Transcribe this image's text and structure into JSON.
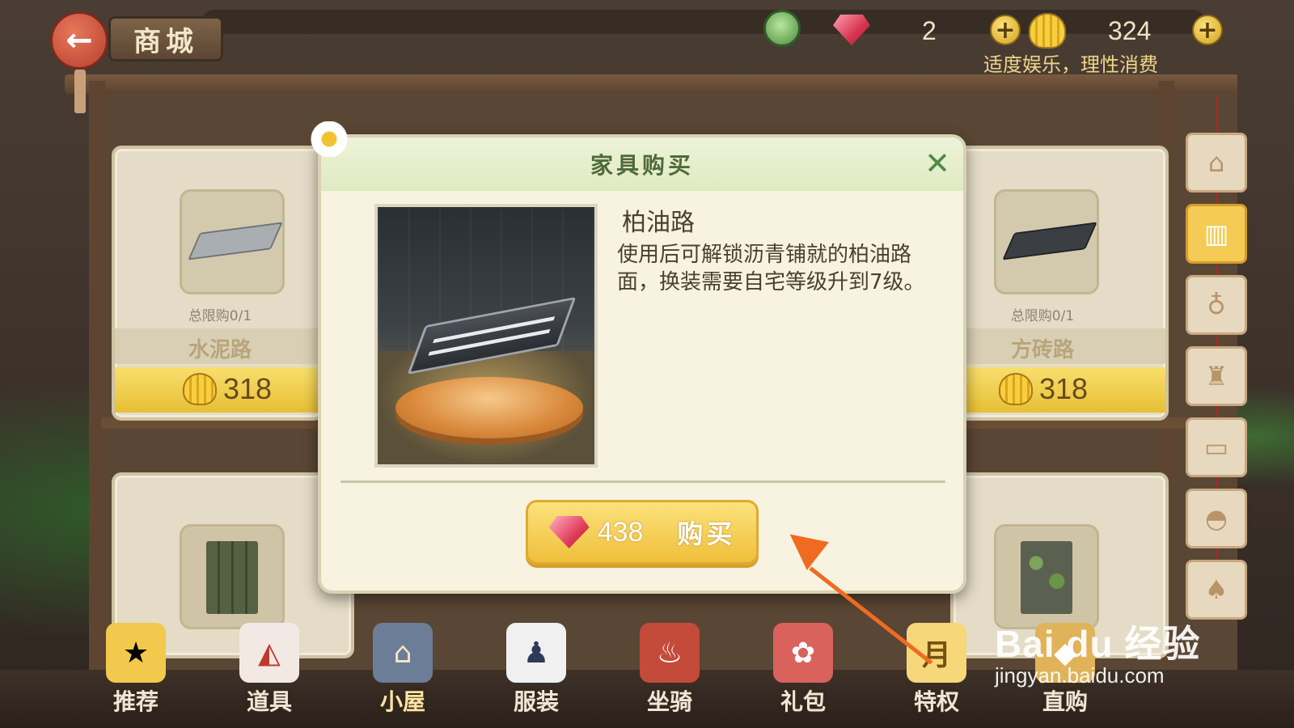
{
  "top_bar": {
    "back_icon": "arrow-left-icon",
    "title": "商城",
    "gem_count": "2",
    "shell_count": "324",
    "notice": "适度娱乐，理性消费"
  },
  "shelf": {
    "cards": [
      {
        "limit": "总限购0/1",
        "name": "水泥路",
        "price": "318",
        "tile_color": "#a8aeb2"
      },
      {
        "limit": "总限购0/1",
        "name": "方砖路",
        "price": "318",
        "tile_color": "#3b3f44"
      }
    ]
  },
  "side_tabs": [
    {
      "icon": "house-icon",
      "glyph": "⌂"
    },
    {
      "icon": "fence-icon",
      "glyph": "▥"
    },
    {
      "icon": "table-icon",
      "glyph": "♁"
    },
    {
      "icon": "chair-icon",
      "glyph": "♜"
    },
    {
      "icon": "bed-icon",
      "glyph": "▭"
    },
    {
      "icon": "fan-icon",
      "glyph": "◓"
    },
    {
      "icon": "lamp-icon",
      "glyph": "♠"
    }
  ],
  "bottom_nav": [
    {
      "label": "推荐",
      "icon": "star-icon",
      "glyph": "★",
      "bg": "#f2c94c"
    },
    {
      "label": "道具",
      "icon": "fox-mask-icon",
      "glyph": "◭",
      "bg": "#f3e9e4"
    },
    {
      "label": "小屋",
      "icon": "house-icon",
      "glyph": "⌂",
      "bg": "#6c7d97"
    },
    {
      "label": "服装",
      "icon": "uniform-icon",
      "glyph": "♟",
      "bg": "#f0f0f0"
    },
    {
      "label": "坐骑",
      "icon": "bicycle-icon",
      "glyph": "♨",
      "bg": "#c44b3a"
    },
    {
      "label": "礼包",
      "icon": "gift-icon",
      "glyph": "✿",
      "bg": "#d9625c"
    },
    {
      "label": "特权",
      "icon": "monthly-card-icon",
      "glyph": "月",
      "bg": "#f6d77a"
    },
    {
      "label": "直购",
      "icon": "direct-buy-icon",
      "glyph": "◆",
      "bg": "#e0b35a"
    }
  ],
  "dialog": {
    "title": "家具购买",
    "close_icon": "close-icon",
    "item_name": "柏油路",
    "item_desc": "使用后可解锁沥青铺就的柏油路面，换装需要自宅等级升到7级。",
    "buy_price": "438",
    "buy_label": "购买"
  },
  "watermark": {
    "logo": "Bai du 经验",
    "url": "jingyan.baidu.com"
  }
}
